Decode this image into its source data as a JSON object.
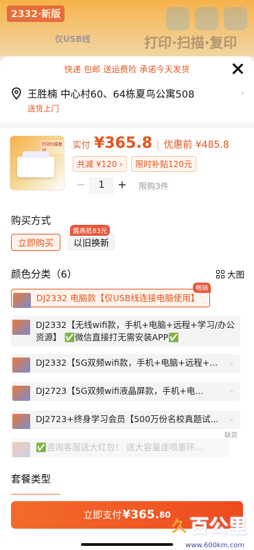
{
  "background": {
    "tag": "2332·新版",
    "text1": "仅USB线",
    "text2": "打印·扫描·复印"
  },
  "banner": "快递 包邮 送运费险 承诺今天发货",
  "address": {
    "text": "王胜楠 中心村60、64栋夏鸟公寓508",
    "sub": "送货上门"
  },
  "product": {
    "paid_label": "实付",
    "paid_price": "¥365.8",
    "separator": "|",
    "pre_label": "优惠前 ¥485.8",
    "badge_discount": "共减 ¥120 ›",
    "badge_subsidy": "限时补贴120元",
    "qty": "1",
    "minus": "−",
    "plus": "+",
    "limit": "限购3件",
    "thumb_label": "打印扫描复印"
  },
  "purchase": {
    "title": "购买方式",
    "opt_buy": "立即购买",
    "opt_trade": "以旧换新",
    "opt_tag": "最高抵83元"
  },
  "colors": {
    "title": "颜色分类（6）",
    "bigpic": "大图",
    "items": [
      {
        "label": "DJ2332 电脑款【仅USB线连接电脑使用】",
        "tag": "畅销"
      },
      {
        "label1": "DJ2332【无线wifi款，手机+电脑+远程+学习/办公",
        "label2": "资源】 ✅微信直接打无需安装APP✅"
      },
      {
        "label": "DJ2332【5G双频wifi款，手机+电脑+远程+..."
      },
      {
        "label": "DJ2723【5G双频wifi液晶屏款，手机+电..."
      },
      {
        "label": "DJ2723+终身学习会员【500万份名校真题试..."
      },
      {
        "label": "✅咨询客服送大红包！ 送大容量连喷墨环...",
        "tag": "缺货"
      }
    ]
  },
  "package": {
    "title": "套餐类型"
  },
  "pay": {
    "label": "立即支付",
    "amount": "¥365.",
    "cents": "80"
  },
  "watermark": {
    "logo": "久",
    "text": "百公里",
    "url": "www.600km.com"
  }
}
